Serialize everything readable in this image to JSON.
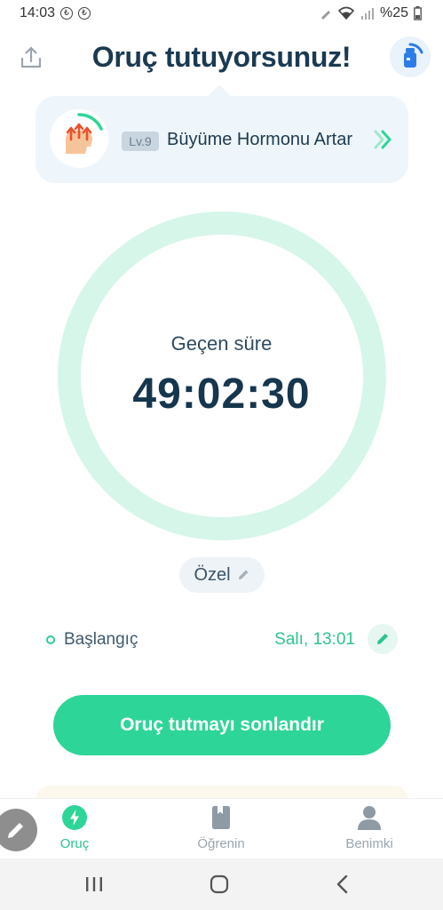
{
  "status_bar": {
    "time": "14:03",
    "battery": "%25"
  },
  "header": {
    "title": "Oruç tutuyorsunuz!"
  },
  "level_card": {
    "badge": "Lv.9",
    "name": "Büyüme Hormonu Artar"
  },
  "timer": {
    "label": "Geçen süre",
    "value": "49:02:30",
    "ring_color": "#d6f6e9"
  },
  "plan": {
    "label": "Özel"
  },
  "start": {
    "label": "Başlangıç",
    "value": "Salı, 13:01"
  },
  "end_button": {
    "label": "Oruç tutmayı sonlandır",
    "color": "#2ed598"
  },
  "bottom_nav": {
    "items": [
      {
        "label": "Oruç",
        "icon": "bolt-icon",
        "active": true
      },
      {
        "label": "Öğrenin",
        "icon": "book-icon",
        "active": false
      },
      {
        "label": "Benimki",
        "icon": "person-icon",
        "active": false
      }
    ]
  },
  "colors": {
    "accent": "#2ed598",
    "title": "#1a3a52"
  }
}
